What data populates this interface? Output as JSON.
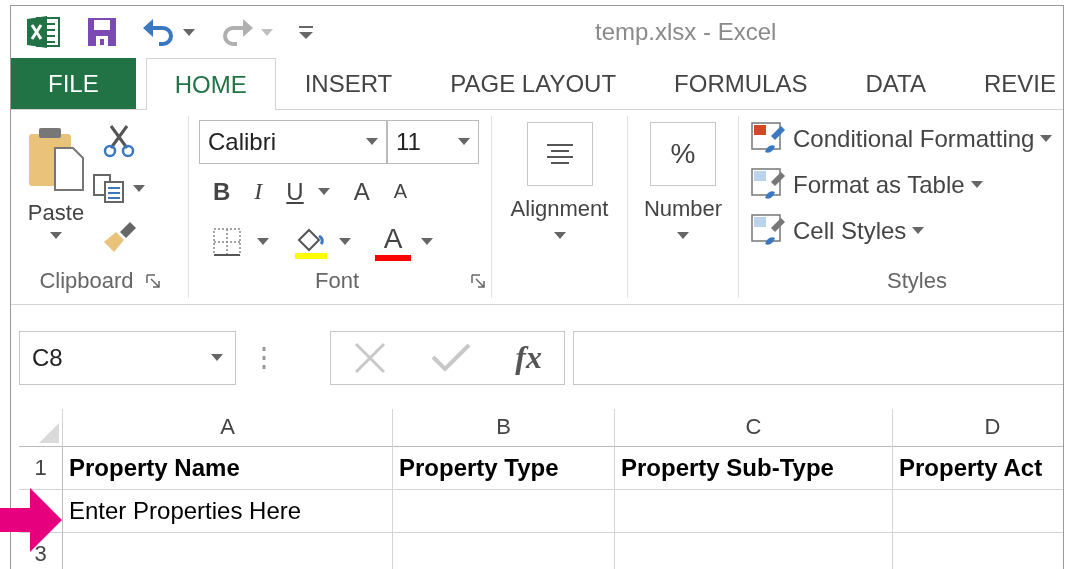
{
  "window": {
    "title": "temp.xlsx - Excel"
  },
  "tabs": [
    {
      "label": "FILE",
      "kind": "file",
      "selected": false
    },
    {
      "label": "HOME",
      "kind": "tab",
      "selected": true
    },
    {
      "label": "INSERT",
      "kind": "tab",
      "selected": false
    },
    {
      "label": "PAGE LAYOUT",
      "kind": "tab",
      "selected": false
    },
    {
      "label": "FORMULAS",
      "kind": "tab",
      "selected": false
    },
    {
      "label": "DATA",
      "kind": "tab",
      "selected": false
    },
    {
      "label": "REVIE",
      "kind": "tab",
      "selected": false
    }
  ],
  "ribbon": {
    "clipboard": {
      "paste": "Paste",
      "label": "Clipboard"
    },
    "font": {
      "name": "Calibri",
      "size": "11",
      "bold": "B",
      "italic": "I",
      "underline": "U",
      "grow": "A",
      "shrink": "A",
      "font_color": "A",
      "label": "Font"
    },
    "alignment": {
      "label": "Alignment"
    },
    "number": {
      "symbol": "%",
      "label": "Number"
    },
    "styles": {
      "items": [
        "Conditional Formatting",
        "Format as Table",
        "Cell Styles"
      ],
      "label": "Styles"
    }
  },
  "formula_bar": {
    "name_box": "C8",
    "function_symbol": "fx"
  },
  "sheet": {
    "columns": [
      "A",
      "B",
      "C",
      "D"
    ],
    "rows": [
      {
        "number": "1",
        "bold": true,
        "cells": [
          "Property Name",
          "Property Type",
          "Property Sub-Type",
          "Property Act"
        ]
      },
      {
        "bold": false,
        "cells": [
          "Enter Properties Here"
        ]
      },
      {
        "number": "3",
        "cells": []
      }
    ]
  }
}
